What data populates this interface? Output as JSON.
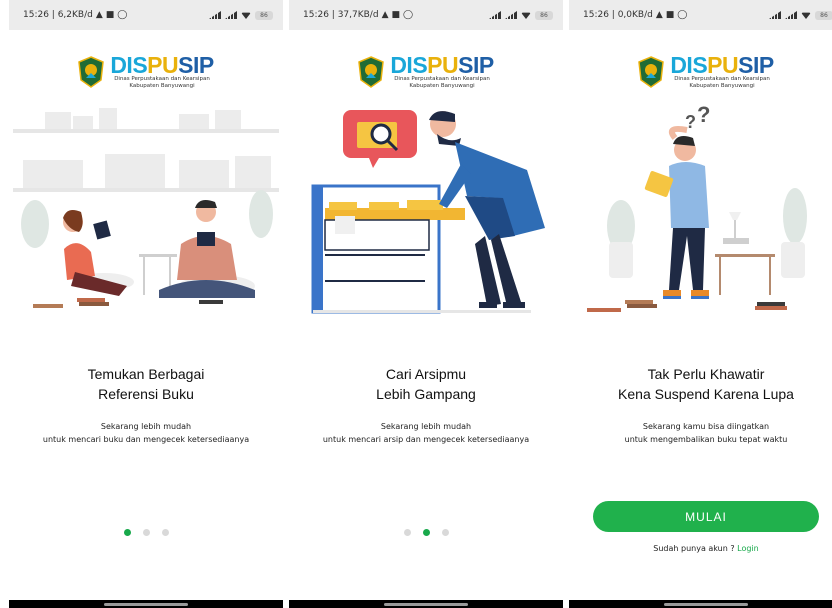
{
  "brand": {
    "name_part1": "DIS",
    "name_part2": "PU",
    "name_part3": "SIP",
    "sub_line1": "Dinas Perpustakaan dan Kearsipan",
    "sub_line2": "Kabupaten Banyuwangi"
  },
  "colors": {
    "primary_green": "#20b14c",
    "brand_blue": "#1aa7d9",
    "brand_yellow": "#e9b10c",
    "brand_navy": "#1f5fa6"
  },
  "screens": [
    {
      "status_time": "15:26 | 6,2KB/d",
      "battery": "86",
      "title_line1": "Temukan Berbagai",
      "title_line2": "Referensi Buku",
      "subtitle_line1": "Sekarang lebih mudah",
      "subtitle_line2": "untuk mencari buku dan mengecek ketersediaanya",
      "active_dot": 0
    },
    {
      "status_time": "15:26 | 37,7KB/d",
      "battery": "86",
      "title_line1": "Cari Arsipmu",
      "title_line2": "Lebih Gampang",
      "subtitle_line1": "Sekarang lebih mudah",
      "subtitle_line2": "untuk mencari arsip dan mengecek ketersediaanya",
      "active_dot": 1
    },
    {
      "status_time": "15:26 | 0,0KB/d",
      "battery": "86",
      "title_line1": "Tak Perlu Khawatir",
      "title_line2": "Kena Suspend Karena Lupa",
      "subtitle_line1": "Sekarang kamu bisa diingatkan",
      "subtitle_line2": "untuk mengembalikan buku tepat waktu",
      "cta_label": "MULAI",
      "login_prompt": "Sudah punya akun ?",
      "login_link": "Login"
    }
  ],
  "icons": [
    "location-icon",
    "notification-icon",
    "whatsapp-icon",
    "signal-icon",
    "wifi-icon",
    "battery-icon"
  ]
}
